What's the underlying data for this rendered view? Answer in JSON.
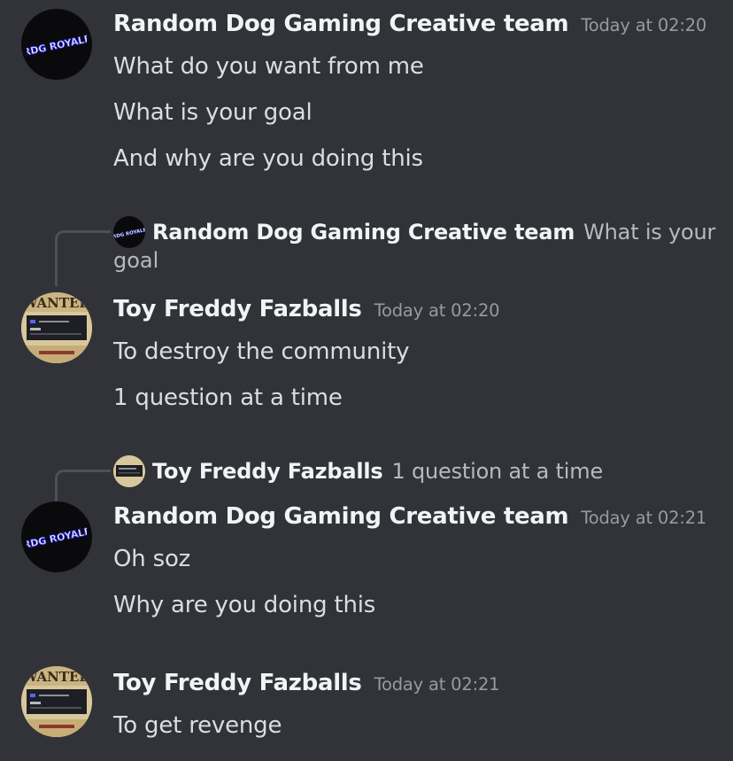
{
  "messages": [
    {
      "author": "Random Dog Gaming Creative team",
      "timestamp": "Today at 02:20",
      "avatar_icon": "rdg-royale-logo",
      "lines": [
        "What do you want from me",
        "What is your goal",
        "And why are you doing this"
      ]
    },
    {
      "reply_to": {
        "author": "Random Dog Gaming Creative team",
        "text_first": "What is your",
        "text_second": "goal"
      },
      "author": "Toy Freddy Fazballs",
      "timestamp": "Today at 02:20",
      "avatar_icon": "wanted-poster",
      "lines": [
        "To destroy the community",
        "1 question at a time"
      ]
    },
    {
      "reply_to": {
        "author": "Toy Freddy Fazballs",
        "text": "1 question at a time"
      },
      "author": "Random Dog Gaming Creative team",
      "timestamp": "Today at 02:21",
      "avatar_icon": "rdg-royale-logo",
      "lines": [
        "Oh soz",
        "Why are you doing this"
      ]
    },
    {
      "author": "Toy Freddy Fazballs",
      "timestamp": "Today at 02:21",
      "avatar_icon": "wanted-poster",
      "lines": [
        "To get revenge"
      ]
    }
  ],
  "avatar_logo_text": "RDG ROYALE",
  "avatar_poster_text": "WANTED",
  "colors": {
    "background": "#313338",
    "username": "#f2f3f5",
    "timestamp": "#949ba4",
    "message_text": "#dbdee1",
    "reply_spine": "#4e5058"
  }
}
